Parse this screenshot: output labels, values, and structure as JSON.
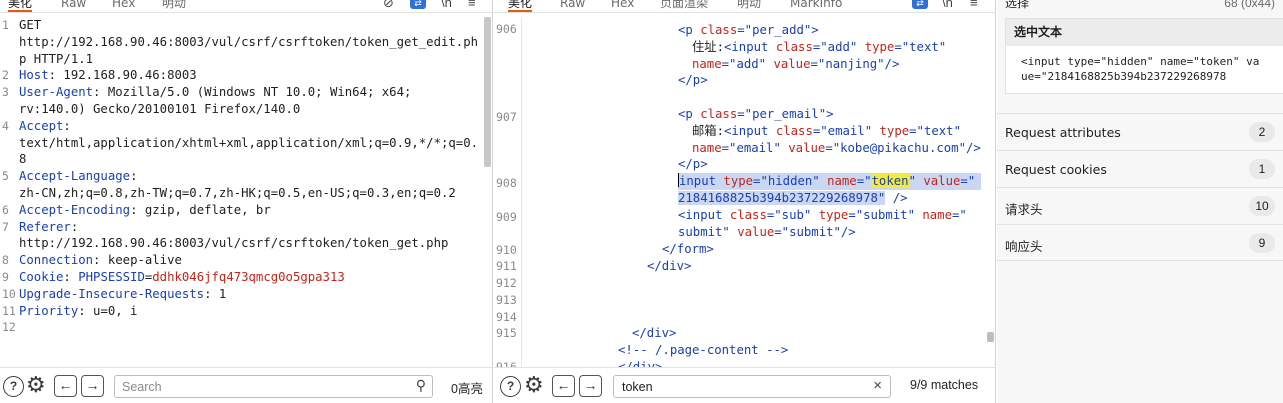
{
  "request_panel": {
    "tabs": [
      "美化",
      "Raw",
      "Hex",
      "明动"
    ],
    "lines": [
      {
        "n": "1",
        "parts": [
          {
            "t": "GET\nhttp://192.168.90.46:8003/vul/csrf/csrftoken/token_get_edit.php HTTP/1.1",
            "c": "hv"
          }
        ]
      },
      {
        "n": "2",
        "parts": [
          {
            "t": "Host",
            "c": "hk"
          },
          {
            "t": ": 192.168.90.46:8003",
            "c": "hv"
          }
        ]
      },
      {
        "n": "3",
        "parts": [
          {
            "t": "User-Agent",
            "c": "hk"
          },
          {
            "t": ": Mozilla/5.0 (Windows NT 10.0; Win64; x64;\nrv:140.0) Gecko/20100101 Firefox/140.0",
            "c": "hv"
          }
        ]
      },
      {
        "n": "4",
        "parts": [
          {
            "t": "Accept",
            "c": "hk"
          },
          {
            "t": ":\ntext/html,application/xhtml+xml,application/xml;q=0.9,*/*;q=0.8",
            "c": "hv"
          }
        ]
      },
      {
        "n": "5",
        "parts": [
          {
            "t": "Accept-Language",
            "c": "hk"
          },
          {
            "t": ":\nzh-CN,zh;q=0.8,zh-TW;q=0.7,zh-HK;q=0.5,en-US;q=0.3,en;q=0.2",
            "c": "hv"
          }
        ]
      },
      {
        "n": "6",
        "parts": [
          {
            "t": "Accept-Encoding",
            "c": "hk"
          },
          {
            "t": ": gzip, deflate, br",
            "c": "hv"
          }
        ]
      },
      {
        "n": "7",
        "parts": [
          {
            "t": "Referer",
            "c": "hk"
          },
          {
            "t": ":\nhttp://192.168.90.46:8003/vul/csrf/csrftoken/token_get.php",
            "c": "hv"
          }
        ]
      },
      {
        "n": "8",
        "parts": [
          {
            "t": "Connection",
            "c": "hk"
          },
          {
            "t": ": keep-alive",
            "c": "hv"
          }
        ]
      },
      {
        "n": "9",
        "parts": [
          {
            "t": "Cookie",
            "c": "hk"
          },
          {
            "t": ": ",
            "c": "hv"
          },
          {
            "t": "PHPSESSID",
            "c": "hk"
          },
          {
            "t": "=",
            "c": "hv"
          },
          {
            "t": "ddhk046jfq473qmcg0o5gpa313",
            "c": "hv-red"
          }
        ]
      },
      {
        "n": "10",
        "parts": [
          {
            "t": "Upgrade-Insecure-Requests",
            "c": "hk"
          },
          {
            "t": ": 1",
            "c": "hv"
          }
        ]
      },
      {
        "n": "11",
        "parts": [
          {
            "t": "Priority",
            "c": "hk"
          },
          {
            "t": ": u=0, i",
            "c": "hv"
          }
        ]
      },
      {
        "n": "12",
        "parts": []
      }
    ],
    "search": {
      "placeholder": "Search",
      "status": "0高亮"
    }
  },
  "response_panel": {
    "tabs": [
      "美化",
      "Raw",
      "Hex",
      "页面渲染",
      "明动",
      "MarkInfo"
    ],
    "search": {
      "value": "token",
      "status": "9/9 matches"
    }
  },
  "inspector": {
    "title": "选择",
    "count": "68 (0x44)",
    "selected_text_title": "选中文本",
    "selected_text": "<input type=\"hidden\" name=\"token\" va\nue=\"2184168825b394b237229268978",
    "rows": [
      {
        "label": "Request attributes",
        "count": "2"
      },
      {
        "label": "Request cookies",
        "count": "1"
      },
      {
        "label": "请求头",
        "count": "10"
      },
      {
        "label": "响应头",
        "count": "9"
      }
    ]
  },
  "colors": {
    "accent": "#e8590c",
    "selection": "#c9d7f2",
    "match": "#f5ea3a",
    "header_key": "#1a3fb0",
    "value_red": "#c0271c"
  }
}
